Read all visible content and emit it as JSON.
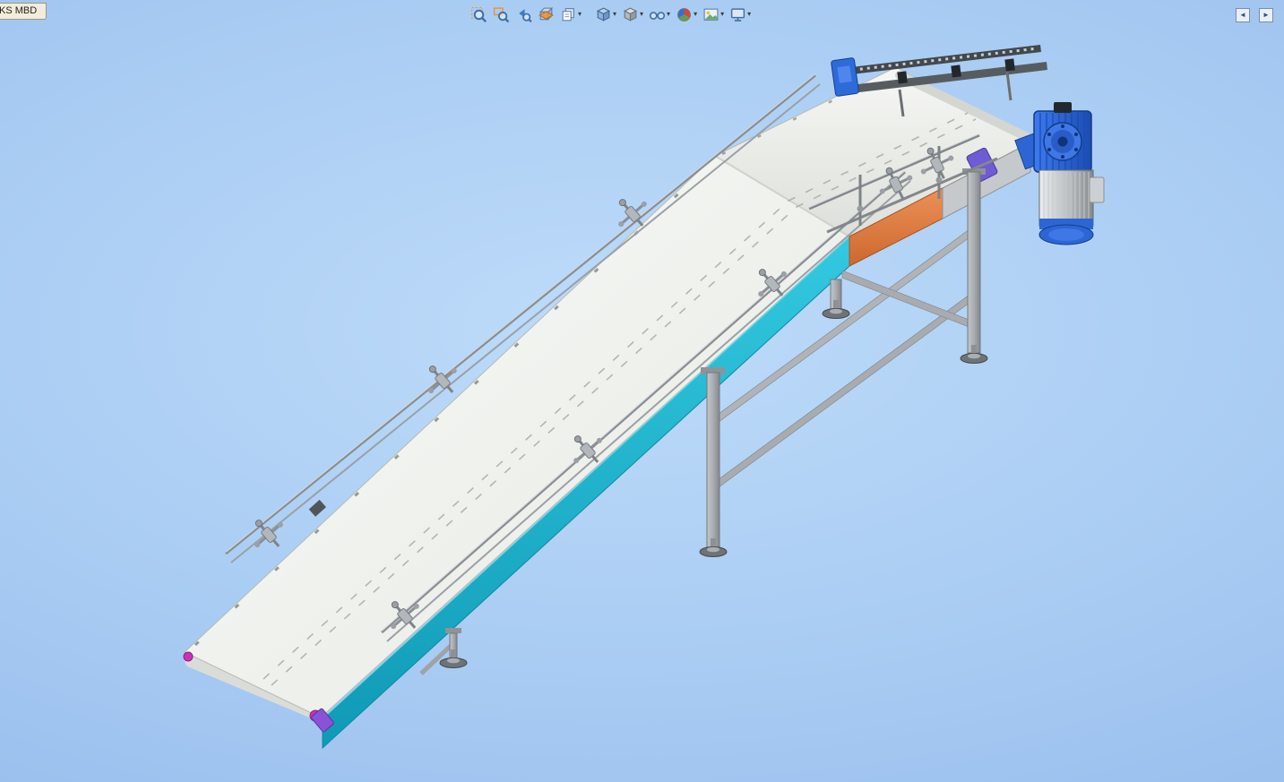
{
  "mbd_tab": {
    "label": "KS MBD"
  },
  "toolbar": {
    "dropdown_glyph": "▾",
    "items": [
      {
        "name": "zoom-to-fit",
        "label": "Zoom to Fit",
        "dropdown": false
      },
      {
        "name": "zoom-to-area",
        "label": "Zoom to Area",
        "dropdown": false
      },
      {
        "name": "previous-view",
        "label": "Previous View",
        "dropdown": false
      },
      {
        "name": "section-view",
        "label": "Section View",
        "dropdown": false
      },
      {
        "name": "annotation-views",
        "label": "Annotation Views",
        "dropdown": true
      },
      {
        "name": "view-orientation",
        "label": "View Orientation",
        "dropdown": true
      },
      {
        "name": "display-style",
        "label": "Display Style",
        "dropdown": true
      },
      {
        "name": "hide-show-items",
        "label": "Hide/Show Items",
        "dropdown": true
      },
      {
        "name": "edit-appearance",
        "label": "Edit Appearance",
        "dropdown": true
      },
      {
        "name": "apply-scene",
        "label": "Apply Scene",
        "dropdown": true
      },
      {
        "name": "view-settings",
        "label": "View Settings",
        "dropdown": true
      }
    ]
  },
  "panel_toggles": {
    "left_glyph": "◄",
    "right_glyph": "►"
  },
  "model": {
    "description": "Inclined belt conveyor with guide rails, support stand and blue gear motor",
    "colors": {
      "background_center": "#bedbf9",
      "background_edge": "#8fb5e9",
      "belt": "#f2f4f0",
      "side_panel_cyan": "#1db4cf",
      "drive_plate_orange": "#e0813f",
      "stand_gray": "#a9adb1",
      "motor_blue": "#2d66d4",
      "tail_cap_magenta": "#cf2fb6",
      "bracket_purple": "#7a5ad8"
    }
  }
}
